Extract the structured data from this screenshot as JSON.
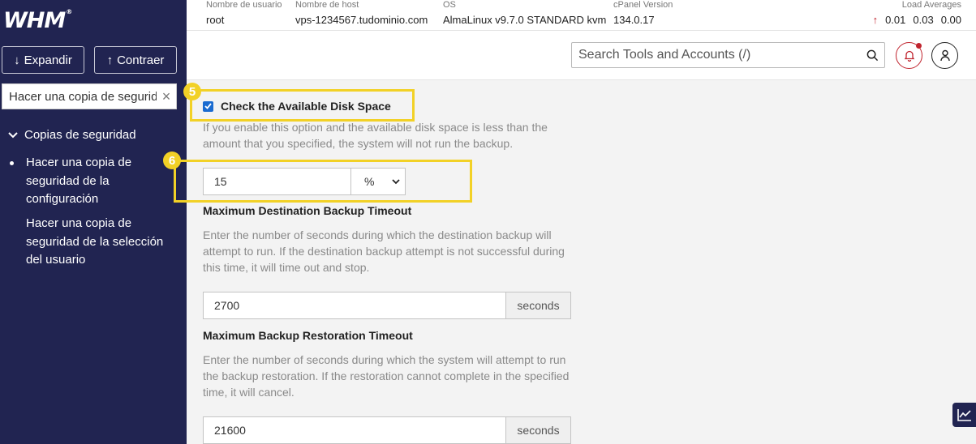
{
  "sidebar": {
    "logo": "WHM",
    "expand_label": "Expandir",
    "collapse_label": "Contraer",
    "search_value": "Hacer una copia de segurid",
    "group_label": "Copias de seguridad",
    "items": [
      {
        "label": "Hacer una copia de seguridad de la configuración"
      },
      {
        "label": "Hacer una copia de seguridad de la selección del usuario"
      }
    ]
  },
  "infobar": {
    "username_label": "Nombre de usuario",
    "username": "root",
    "hostname_label": "Nombre de host",
    "hostname": "vps-1234567.tudominio.com",
    "os_label": "OS",
    "os": "AlmaLinux v9.7.0 STANDARD kvm",
    "cpanel_label": "cPanel Version",
    "cpanel": "134.0.17",
    "loads_label": "Load Averages",
    "loads": [
      "0.01",
      "0.03",
      "0.00"
    ]
  },
  "header": {
    "search_placeholder": "Search Tools and Accounts (/)"
  },
  "form": {
    "disk_check_label": "Check the Available Disk Space",
    "disk_check_checked": true,
    "disk_check_help": "If you enable this option and the available disk space is less than the amount that you specified, the system will not run the backup.",
    "disk_value": "15",
    "disk_unit": "%",
    "dest_timeout_title": "Maximum Destination Backup Timeout",
    "dest_timeout_help": "Enter the number of seconds during which the destination backup will attempt to run. If the destination backup attempt is not successful during this time, it will time out and stop.",
    "dest_timeout_value": "2700",
    "dest_timeout_unit": "seconds",
    "restore_timeout_title": "Maximum Backup Restoration Timeout",
    "restore_timeout_help": "Enter the number of seconds during which the system will attempt to run the backup restoration. If the restoration cannot complete in the specified time, it will cancel.",
    "restore_timeout_value": "21600",
    "restore_timeout_unit": "seconds"
  },
  "annotations": {
    "badge_5": "5",
    "badge_6": "6",
    "highlight_color": "#f2d126"
  },
  "colors": {
    "sidebar_bg": "#212451",
    "accent_red": "#c0242e",
    "checkbox_blue": "#1a6bd0"
  }
}
